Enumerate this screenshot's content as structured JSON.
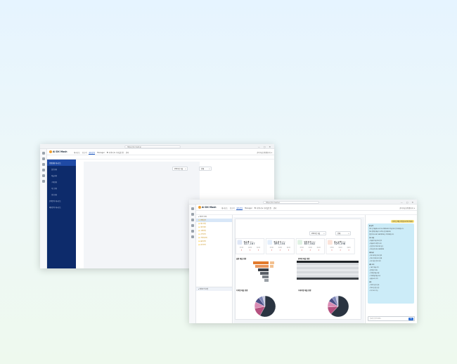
{
  "app": {
    "title": "AI DX Mash",
    "url": "https://dx.mash.ai",
    "nav_tabs": [
      "대시보드",
      "보고서",
      "예측분석",
      "Manager",
      "BI 커넥터 & 디지털트윈",
      "관리"
    ],
    "nav_active_index": 2,
    "user": "관리자님 환영합니다 ▾",
    "subtabs": [
      "종합현황 대시보드",
      "매출현황"
    ]
  },
  "sidebar": {
    "items": [
      {
        "label": "종합현황 대시보드",
        "selected": true
      },
      {
        "label": "월간현황",
        "sub": true
      },
      {
        "label": "매출현황",
        "sub": true
      },
      {
        "label": "구매현황",
        "sub": true
      },
      {
        "label": "재고현황",
        "sub": true
      },
      {
        "label": "생산현황",
        "sub": true
      },
      {
        "label": "손익분석 대시보드",
        "selected": false
      },
      {
        "label": "예측분석 대시보드",
        "selected": false
      }
    ]
  },
  "tree": {
    "items": [
      {
        "label": "▾ 데이터 목록",
        "type": "root"
      },
      {
        "label": "📁 판매실적",
        "type": "folder"
      },
      {
        "label": "📁 재고현황",
        "type": "folder"
      },
      {
        "label": "📁 생산계획",
        "type": "folder"
      },
      {
        "label": "📁 구매현황",
        "type": "folder"
      },
      {
        "label": "📁 손익분석",
        "type": "folder"
      },
      {
        "label": "📁 거래처관리",
        "type": "folder"
      },
      {
        "label": "📁 품목관리",
        "type": "folder"
      },
      {
        "label": "📁 원가분석",
        "type": "folder"
      }
    ],
    "bottom_label": "▸ 예측분석 모델"
  },
  "filters": {
    "period": "2024년 1월",
    "company": "전체"
  },
  "kpis": [
    {
      "name": "매 출 액",
      "unit": "(백만원)",
      "value": "427,167",
      "c1": "전월대비",
      "c2": "전년대비",
      "c3": "목표대비",
      "v1": "▲",
      "v2": "▲",
      "v3": "▲",
      "color": "#2f62c9",
      "bg": "#dfe7f6"
    },
    {
      "name": "매 출 원 가",
      "unit": "(백만원)",
      "value": "495,154",
      "c1": "전월대비",
      "c2": "전년대비",
      "c3": "목표대비",
      "v1": "▲",
      "v2": "▲",
      "v3": "▲",
      "color": "#4a86d8",
      "bg": "#e3eefb"
    },
    {
      "name": "영 업 이 익",
      "unit": "(백만원)",
      "value": "837,582",
      "c1": "전월대비",
      "c2": "전년대비",
      "c3": "목표대비",
      "v1": "▲",
      "v2": "▲",
      "v3": "▲",
      "color": "#3c9a54",
      "bg": "#dff1e3"
    },
    {
      "name": "재 고 금 액",
      "unit": "(백만원)",
      "value": "529,198",
      "c1": "전월대비",
      "c2": "전년대비",
      "c3": "목표대비",
      "v1": "▲",
      "v2": "▲",
      "v3": "▲",
      "color": "#e0572a",
      "bg": "#fbe3d9"
    }
  ],
  "sections": {
    "monthly": "월별 매출 현황",
    "category": "품목별 매출 현황",
    "regional": "지역별 매출 현황",
    "customer": "거래처별 매출 현황"
  },
  "chat": {
    "user_question": "이번 달 매출 현황을 요약해 주세요",
    "answer_lines": [
      {
        "t": "AI 답변",
        "h": true
      },
      {
        "t": "이번 달 매출액은 427,167백만원으로 전월 대비 증가하였습니다."
      },
      {
        "t": "주요 품목별 매출이 고르게 상승하였으며,"
      },
      {
        "t": "영업이익은 837,582백만원을 기록하였습니다."
      },
      {
        "t": "주요 내용",
        "h": true
      },
      {
        "t": "• 매출액 전월 대비 증가"
      },
      {
        "t": "• 매출원가 안정적 유지"
      },
      {
        "t": "• 영업이익 목표 대비 달성"
      },
      {
        "t": "• 재고금액 529,198백만원"
      },
      {
        "t": "권장사항",
        "h": true
      },
      {
        "t": "• 재고 회전율 개선 검토"
      },
      {
        "t": "• 주요 거래처 관리 강화"
      },
      {
        "t": "• 원가 절감 방안 모색"
      },
      {
        "t": "세부 분석",
        "h": true
      },
      {
        "t": "• 1분기 매출 추이"
      },
      {
        "t": "• 품목별 기여도"
      },
      {
        "t": "• 지역별 매출 비중"
      },
      {
        "t": "• 거래처별 매출 순위"
      },
      {
        "t": "• 월별 손익 추이"
      },
      {
        "t": "요약",
        "h": true
      },
      {
        "t": "• 전반적 실적 양호"
      },
      {
        "t": "• 목표 달성률 상승"
      },
      {
        "t": "• 추가 분석 가능"
      }
    ],
    "input_placeholder": "질문을 입력하세요...",
    "send_label": "전송"
  },
  "chart_data": [
    {
      "type": "pie",
      "title": "",
      "categories": [
        "A",
        "B",
        "C",
        "D",
        "E",
        "F"
      ],
      "values": [
        58,
        14,
        10,
        8,
        6,
        4
      ],
      "colors": [
        "#2a3441",
        "#b5507f",
        "#d98cb4",
        "#4b4f86",
        "#7f87b8",
        "#c7cbe3"
      ]
    },
    {
      "type": "pie",
      "title": "",
      "categories": [
        "A",
        "B",
        "C",
        "D",
        "E",
        "F"
      ],
      "values": [
        62,
        12,
        9,
        7,
        6,
        4
      ],
      "colors": [
        "#2a3441",
        "#b5507f",
        "#d98cb4",
        "#4b4f86",
        "#7f87b8",
        "#c7cbe3"
      ]
    }
  ]
}
